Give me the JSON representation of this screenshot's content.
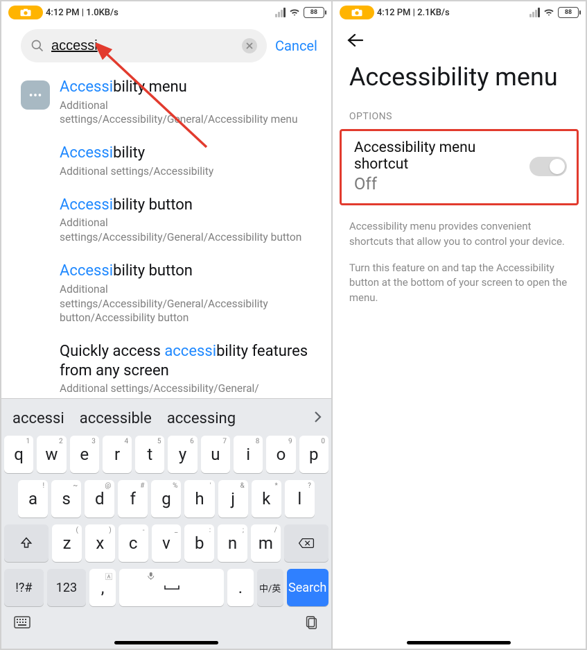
{
  "left": {
    "status": {
      "time": "4:12 PM",
      "net": "1.0KB/s",
      "battery": "88"
    },
    "search": {
      "query": "accessi",
      "cancel": "Cancel"
    },
    "results": [
      {
        "title_pre": "Accessi",
        "title_post": "bility menu",
        "path": "Additional settings/Accessibility/General/Accessibility menu"
      },
      {
        "title_pre": "Accessi",
        "title_post": "bility",
        "path": "Additional settings/Accessibility"
      },
      {
        "title_pre": "Accessi",
        "title_post": "bility button",
        "path": "Additional settings/Accessibility/General/Accessibility button"
      },
      {
        "title_pre": "Accessi",
        "title_post": "bility button",
        "path": "Additional settings/Accessibility/General/Accessibility button/Accessibility button"
      },
      {
        "title_pre2": "Quickly access ",
        "title_hl": "accessi",
        "title_post2": "bility features from any screen",
        "path": "Additional settings/Accessibility/General/"
      }
    ],
    "keyboard": {
      "suggestions": [
        "accessi",
        "accessible",
        "accessing"
      ],
      "row1": [
        {
          "k": "q",
          "s": "1"
        },
        {
          "k": "w",
          "s": "2"
        },
        {
          "k": "e",
          "s": "3"
        },
        {
          "k": "r",
          "s": "4"
        },
        {
          "k": "t",
          "s": "5"
        },
        {
          "k": "y",
          "s": "6"
        },
        {
          "k": "u",
          "s": "7"
        },
        {
          "k": "i",
          "s": "8"
        },
        {
          "k": "o",
          "s": "9"
        },
        {
          "k": "p",
          "s": "0"
        }
      ],
      "row2": [
        {
          "k": "a",
          "s": "!"
        },
        {
          "k": "s",
          "s": "~"
        },
        {
          "k": "d",
          "s": "@"
        },
        {
          "k": "f",
          "s": "#"
        },
        {
          "k": "g",
          "s": "%"
        },
        {
          "k": "h",
          "s": "'"
        },
        {
          "k": "j",
          "s": "&"
        },
        {
          "k": "k",
          "s": "*"
        },
        {
          "k": "l",
          "s": "?"
        }
      ],
      "row3": [
        {
          "k": "z",
          "s": "("
        },
        {
          "k": "x",
          "s": ")"
        },
        {
          "k": "c",
          "s": "-"
        },
        {
          "k": "v",
          "s": "_"
        },
        {
          "k": "b",
          "s": ":"
        },
        {
          "k": "n",
          "s": ";"
        },
        {
          "k": "m",
          "s": "/"
        }
      ],
      "row4": {
        "sym": "!?#",
        "num": "123",
        "comma": ",",
        "period": ".",
        "lang": "中/英",
        "search": "Search"
      }
    }
  },
  "right": {
    "status": {
      "time": "4:12 PM",
      "net": "2.1KB/s",
      "battery": "88"
    },
    "title": "Accessibility menu",
    "section": "OPTIONS",
    "setting": {
      "title": "Accessibility menu shortcut",
      "state": "Off"
    },
    "help1": "Accessibility menu provides convenient shortcuts that allow you to control your device.",
    "help2": "Turn this feature on and tap the Accessibility button at the bottom of your screen to open the menu."
  }
}
